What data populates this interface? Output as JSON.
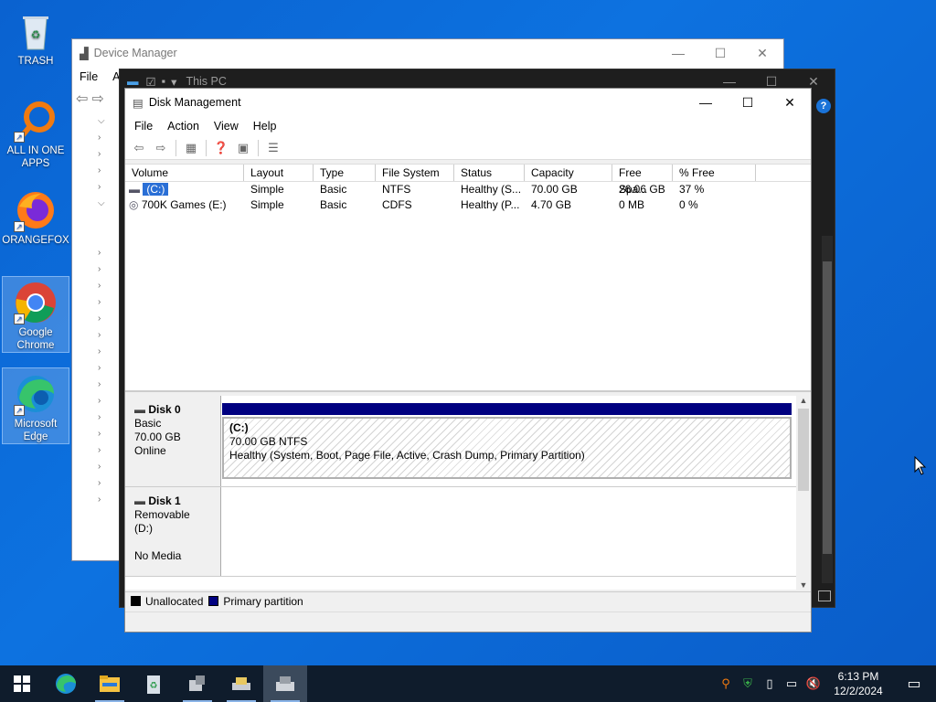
{
  "desktop": {
    "icons": [
      {
        "label": "TRASH",
        "icon": "recycle-bin-icon"
      },
      {
        "label": "ALL IN ONE APPS",
        "icon": "magnifier-app-icon"
      },
      {
        "label": "ORANGEFOX",
        "icon": "firefox-icon"
      },
      {
        "label": "Google Chrome",
        "icon": "chrome-icon"
      },
      {
        "label": "Microsoft Edge",
        "icon": "edge-icon"
      }
    ]
  },
  "device_manager": {
    "title": "Device Manager",
    "menu": [
      "File",
      "A"
    ]
  },
  "this_pc": {
    "title": "This PC"
  },
  "disk_management": {
    "title": "Disk Management",
    "menu": [
      "File",
      "Action",
      "View",
      "Help"
    ],
    "columns": [
      "Volume",
      "Layout",
      "Type",
      "File System",
      "Status",
      "Capacity",
      "Free Spa...",
      "% Free"
    ],
    "volumes": [
      {
        "volume": "(C:)",
        "layout": "Simple",
        "type": "Basic",
        "fs": "NTFS",
        "status": "Healthy (S...",
        "capacity": "70.00 GB",
        "free": "26.06 GB",
        "pct": "37 %"
      },
      {
        "volume": "700K Games (E:)",
        "layout": "Simple",
        "type": "Basic",
        "fs": "CDFS",
        "status": "Healthy (P...",
        "capacity": "4.70 GB",
        "free": "0 MB",
        "pct": "0 %"
      }
    ],
    "disks": [
      {
        "name": "Disk 0",
        "type": "Basic",
        "size": "70.00 GB",
        "state": "Online",
        "partition": {
          "label": "(C:)",
          "size": "70.00 GB NTFS",
          "status": "Healthy (System, Boot, Page File, Active, Crash Dump, Primary Partition)"
        }
      },
      {
        "name": "Disk 1",
        "type": "Removable (D:)",
        "size": "",
        "state": "No Media"
      }
    ],
    "legend": [
      {
        "label": "Unallocated",
        "color": "#000000"
      },
      {
        "label": "Primary partition",
        "color": "#000080"
      }
    ]
  },
  "taskbar": {
    "apps": [
      "start-icon",
      "edge-icon",
      "file-explorer-icon",
      "recycle-tool-icon",
      "device-manager-icon",
      "drive-icon",
      "disk-management-icon"
    ],
    "time": "6:13 PM",
    "date": "12/2/2024"
  }
}
